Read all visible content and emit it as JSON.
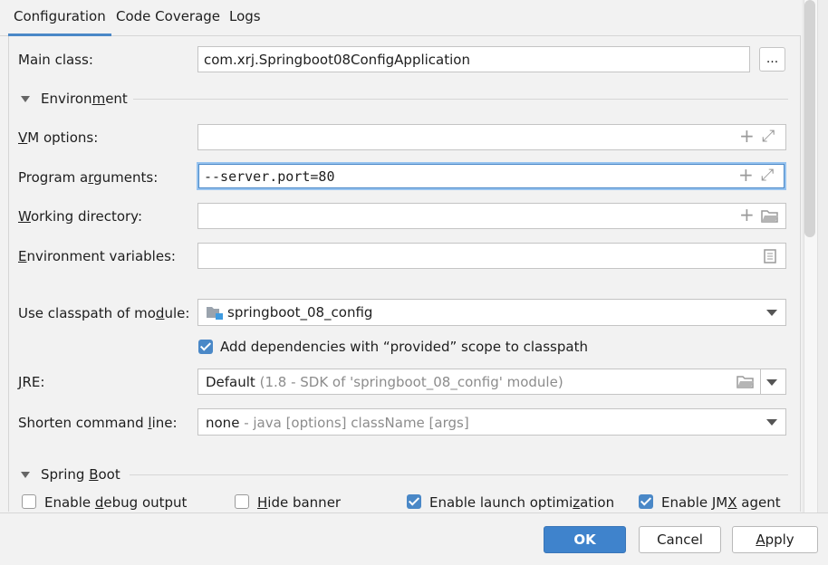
{
  "tabs": [
    {
      "label": "Configuration",
      "active": true
    },
    {
      "label": "Code Coverage",
      "active": false
    },
    {
      "label": "Logs",
      "active": false
    }
  ],
  "main_class": {
    "label": "Main class:",
    "value": "com.xrj.Springboot08ConfigApplication",
    "browse_label": "..."
  },
  "environment_section": {
    "pre": "Environ",
    "mnemonic": "m",
    "post": "ent"
  },
  "vm_options": {
    "mnemonic": "V",
    "post": "M options:",
    "value": ""
  },
  "program_arguments": {
    "pre": "Program a",
    "mnemonic": "r",
    "post": "guments:",
    "value": "--server.port=80"
  },
  "working_directory": {
    "mnemonic": "W",
    "post": "orking directory:",
    "value": ""
  },
  "environment_variables": {
    "mnemonic": "E",
    "post": "nvironment variables:",
    "value": ""
  },
  "classpath_module": {
    "pre": "Use classpath of mo",
    "mnemonic": "d",
    "post": "ule:",
    "value": "springboot_08_config"
  },
  "add_dependencies": {
    "label": "Add dependencies with “provided” scope to classpath",
    "checked": true
  },
  "jre": {
    "mnemonic": "J",
    "post": "RE:",
    "value": "Default",
    "hint": "(1.8 - SDK of 'springboot_08_config' module)"
  },
  "shorten_command_line": {
    "pre": "Shorten command ",
    "mnemonic": "l",
    "post": "ine:",
    "value": "none",
    "hint": "- java [options] className [args]"
  },
  "spring_boot_section": {
    "pre": "Spring ",
    "mnemonic": "B",
    "post": "oot"
  },
  "spring_options": [
    {
      "pre": "Enable ",
      "mnemonic": "d",
      "post": "ebug output",
      "checked": false
    },
    {
      "pre": "",
      "mnemonic": "H",
      "post": "ide banner",
      "checked": false
    },
    {
      "pre": "Enable launch optimi",
      "mnemonic": "z",
      "post": "ation",
      "checked": true
    },
    {
      "pre": "Enable JM",
      "mnemonic": "X",
      "post": " agent",
      "checked": true
    }
  ],
  "footer": {
    "ok_label": "OK",
    "cancel_label": "Cancel",
    "apply_pre": "",
    "apply_mnemonic": "A",
    "apply_post": "pply"
  },
  "colors": {
    "accent": "#4a88c7",
    "primary_button": "#3f83cc",
    "background": "#f2f2f2"
  }
}
